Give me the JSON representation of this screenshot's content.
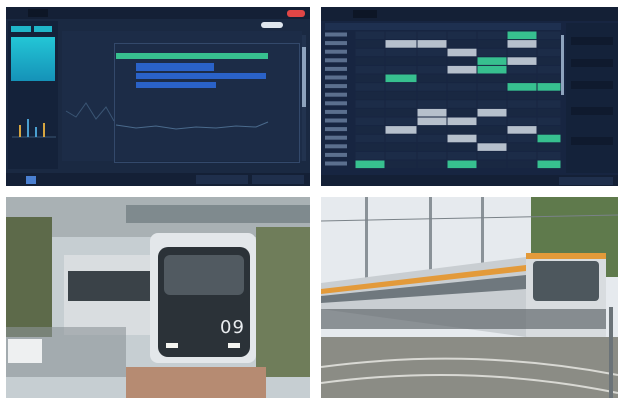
{
  "colors": {
    "dashboard_bg": "#1a2942",
    "dashboard_panel": "#14223a",
    "accent_cyan": "#1fb6c9",
    "accent_green": "#37c08f",
    "accent_blue": "#2a62c8",
    "alert_red": "#e04646"
  },
  "photo_left": {
    "car_number": "09"
  },
  "icons": {
    "top_left_toggle": "toggle-switch-icon",
    "top_left_close": "close-button-icon",
    "bottom_left_icon": "grid-icon"
  }
}
